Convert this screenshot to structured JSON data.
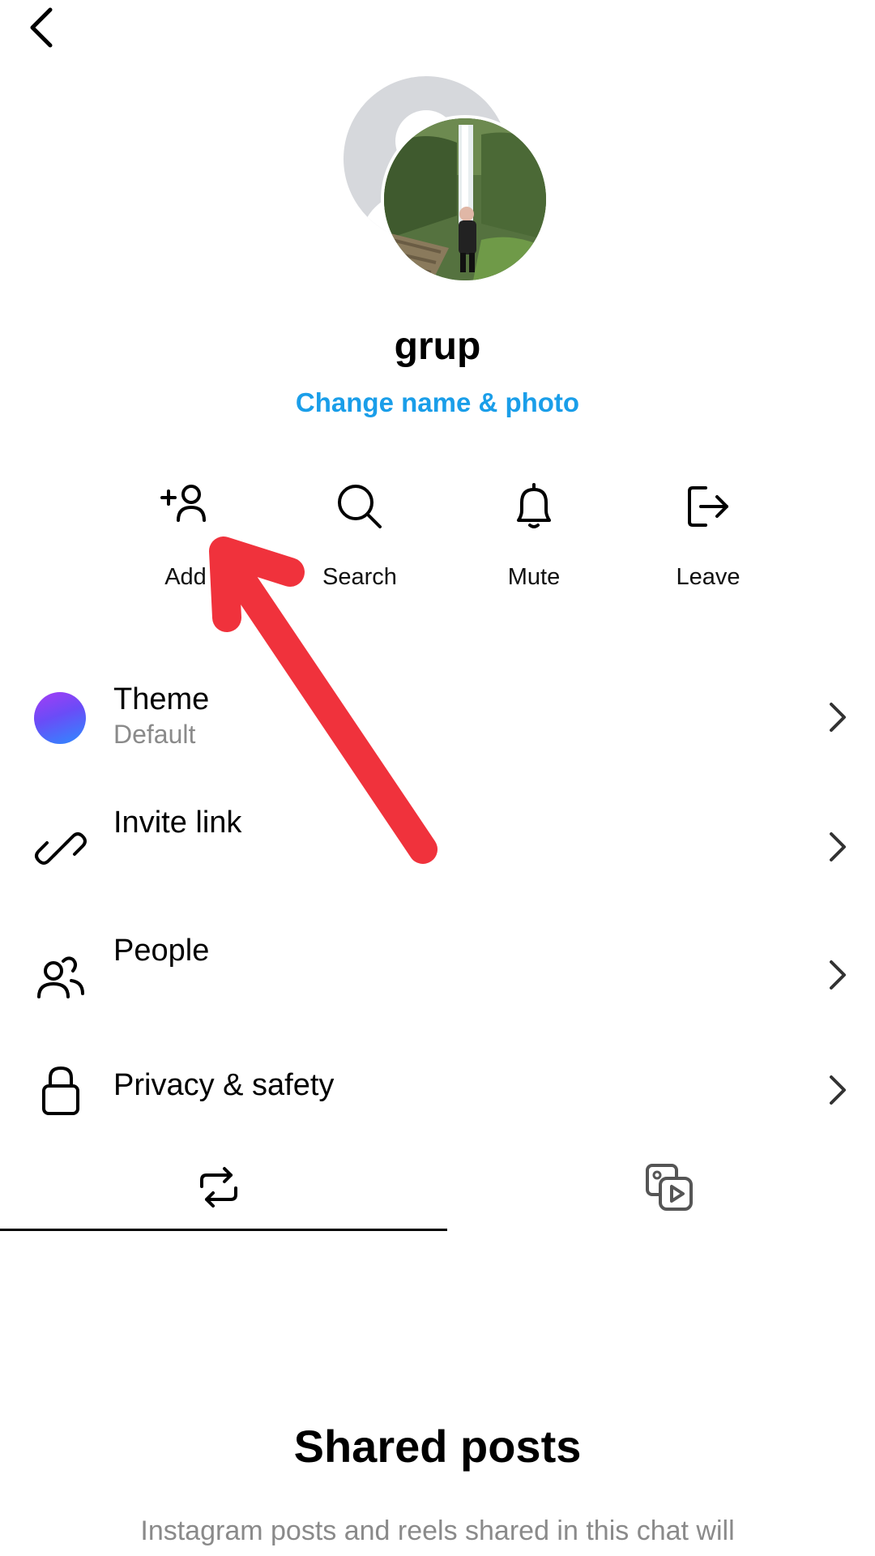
{
  "header": {
    "back_icon": "chevron-left-icon"
  },
  "group": {
    "name": "grup",
    "change_link": "Change name & photo"
  },
  "actions": [
    {
      "label": "Add",
      "icon": "add-person-icon"
    },
    {
      "label": "Search",
      "icon": "search-icon"
    },
    {
      "label": "Mute",
      "icon": "bell-icon"
    },
    {
      "label": "Leave",
      "icon": "leave-icon"
    }
  ],
  "settings": [
    {
      "title": "Theme",
      "subtitle": "Default",
      "icon": "theme-color-dot"
    },
    {
      "title": "Invite link",
      "icon": "link-icon"
    },
    {
      "title": "People",
      "icon": "people-icon"
    },
    {
      "title": "Privacy & safety",
      "icon": "lock-icon"
    }
  ],
  "tabs": [
    {
      "icon": "repost-icon",
      "active": true
    },
    {
      "icon": "media-icon",
      "active": false
    }
  ],
  "empty_state": {
    "title": "Shared posts",
    "description": "Instagram posts and reels shared in this chat will"
  },
  "colors": {
    "link": "#1a9ee9",
    "annotation_arrow": "#f0323c",
    "theme_gradient": [
      "#a53cf5",
      "#2d8bff"
    ]
  }
}
